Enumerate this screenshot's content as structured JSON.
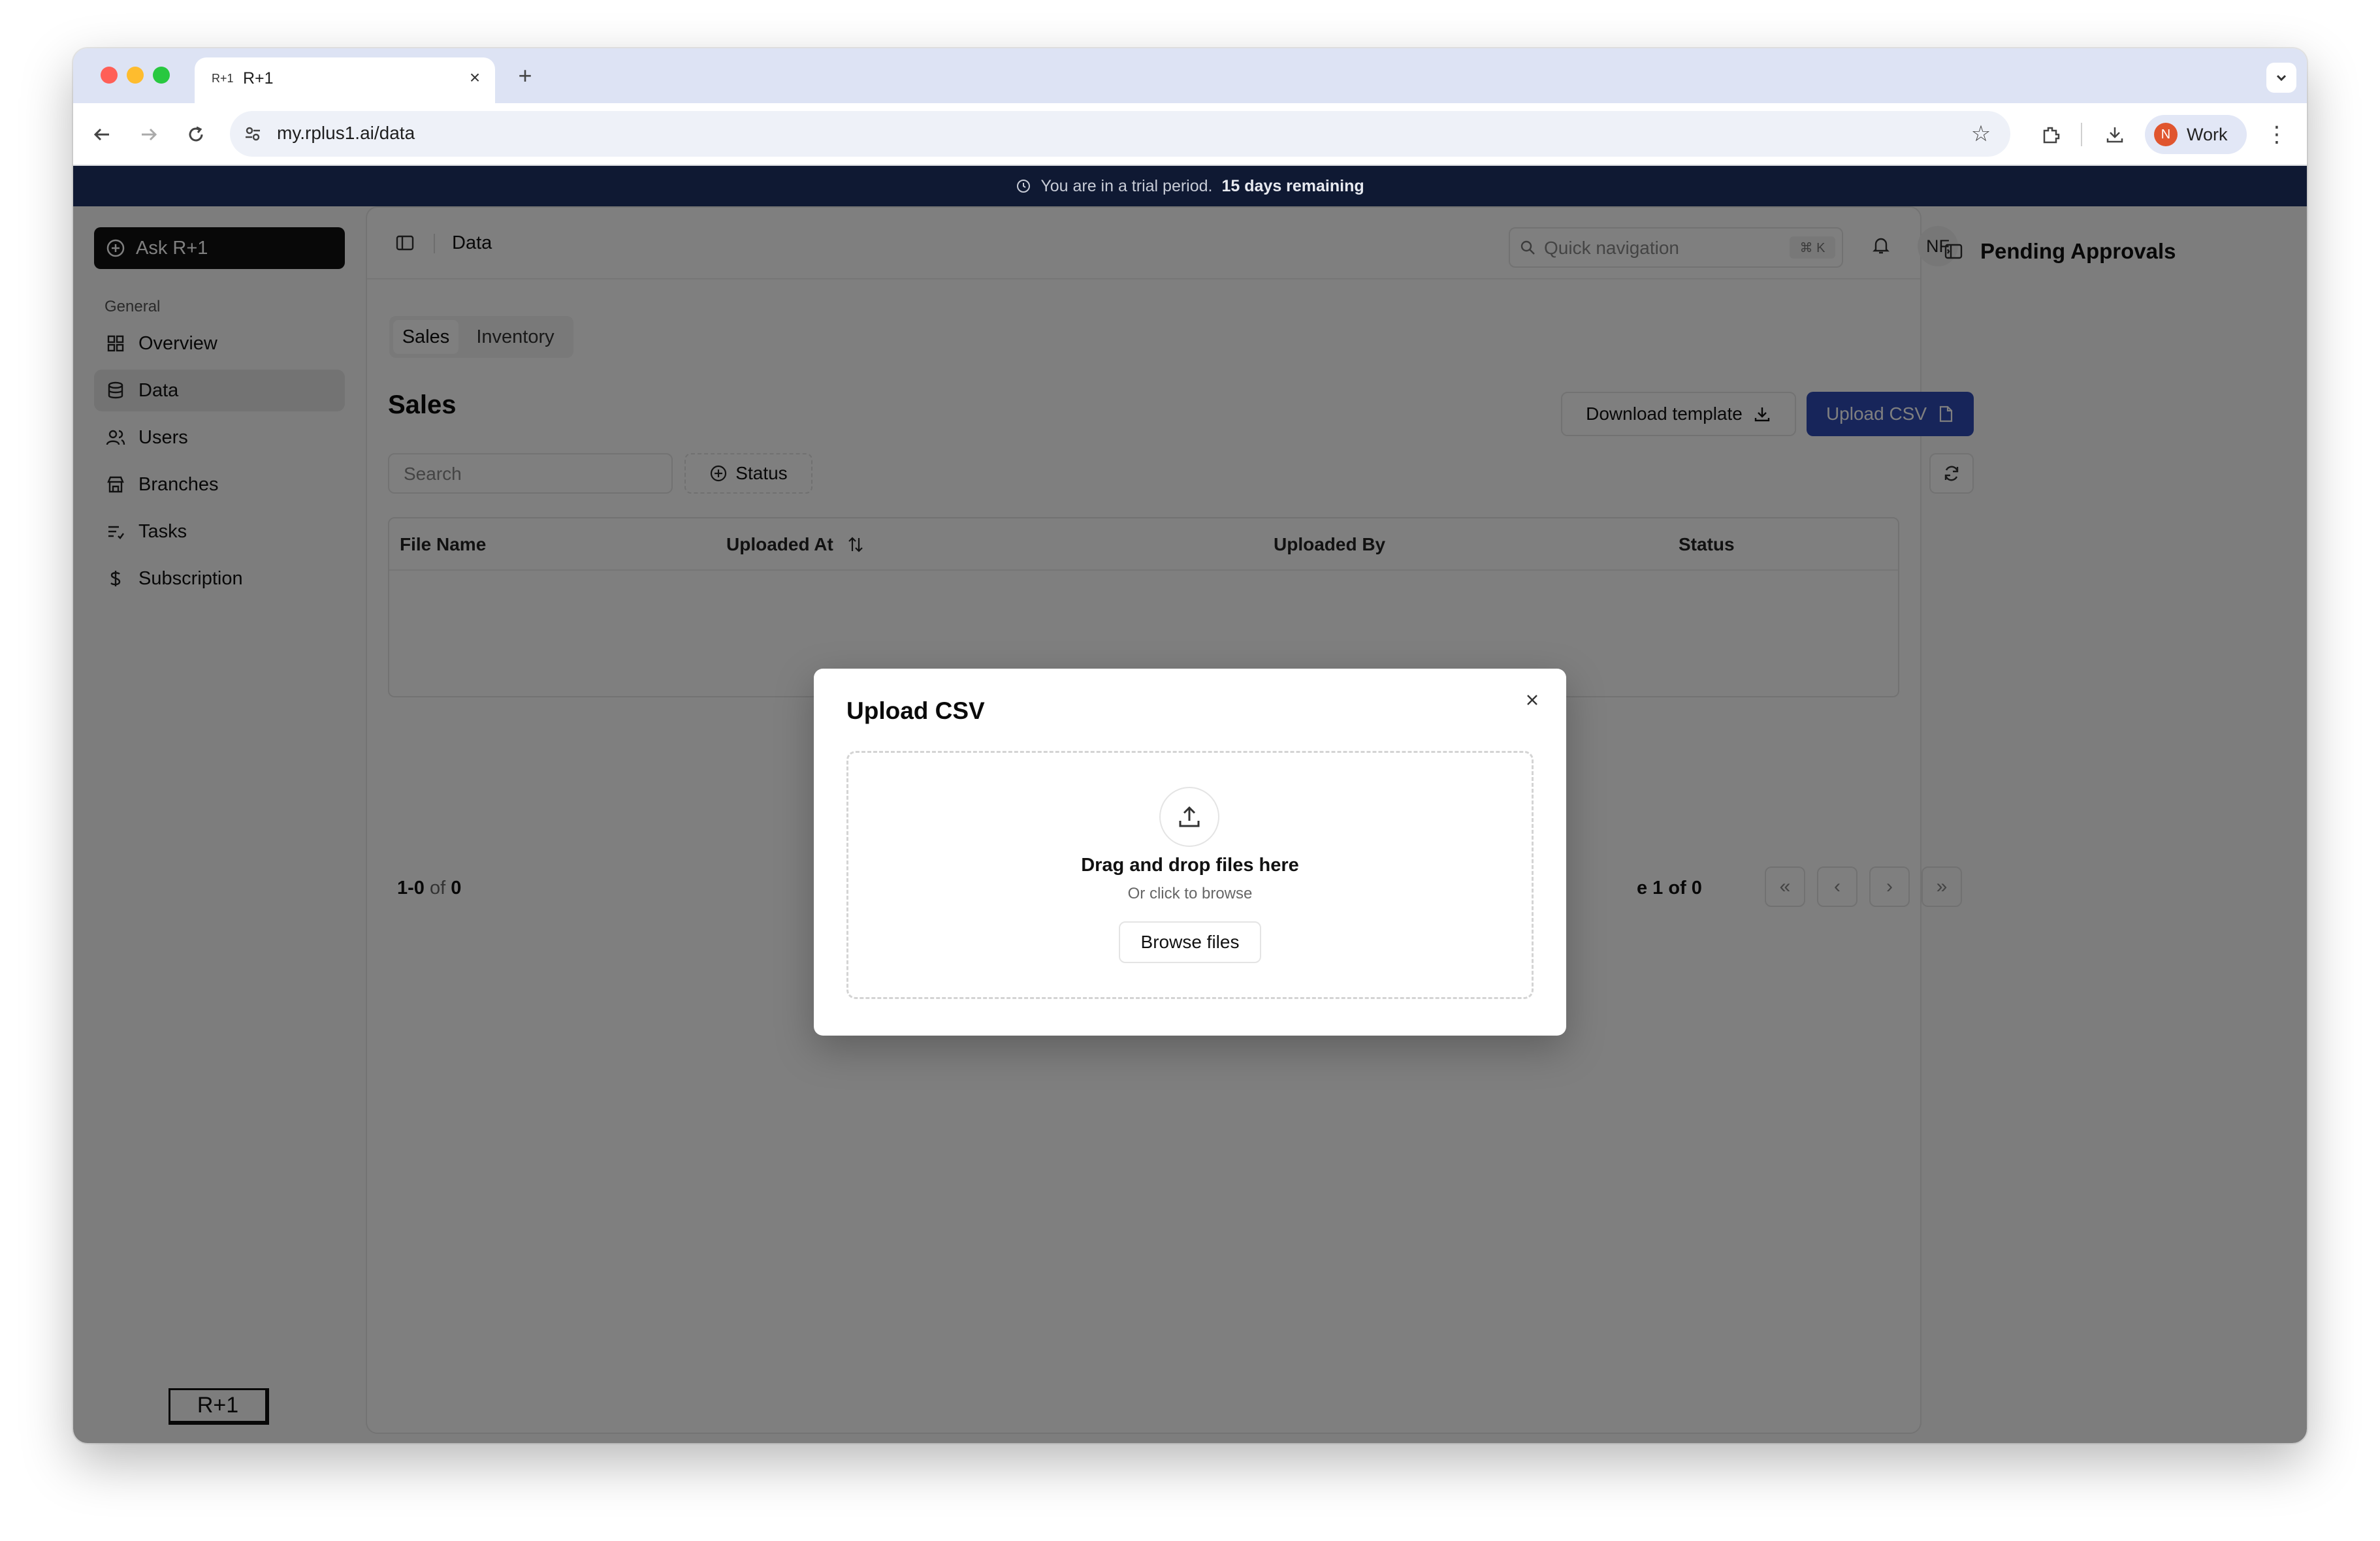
{
  "browser": {
    "tab_icon_text": "R+1",
    "tab_title": "R+1",
    "url": "my.rplus1.ai/data",
    "profile_initial": "N",
    "profile_label": "Work"
  },
  "banner": {
    "text": "You are in a trial period.",
    "emphasis": "15 days remaining"
  },
  "sidebar": {
    "ask_label": "Ask R+1",
    "section_label": "General",
    "items": [
      {
        "label": "Overview",
        "icon": "grid-icon"
      },
      {
        "label": "Data",
        "icon": "database-icon",
        "active": true
      },
      {
        "label": "Users",
        "icon": "users-icon"
      },
      {
        "label": "Branches",
        "icon": "store-icon"
      },
      {
        "label": "Tasks",
        "icon": "list-icon"
      },
      {
        "label": "Subscription",
        "icon": "dollar-icon"
      }
    ],
    "logo_text": "R+1"
  },
  "header": {
    "breadcrumb": "Data",
    "search_placeholder": "Quick navigation",
    "shortcut": "⌘ K",
    "avatar_initials": "NF"
  },
  "tabs": [
    {
      "label": "Sales",
      "active": true
    },
    {
      "label": "Inventory",
      "active": false
    }
  ],
  "content": {
    "title": "Sales",
    "download_label": "Download template",
    "upload_label": "Upload CSV",
    "search_placeholder": "Search",
    "status_filter_label": "Status"
  },
  "table": {
    "columns": [
      "File Name",
      "Uploaded At",
      "Uploaded By",
      "Status"
    ],
    "rows": []
  },
  "pagination": {
    "range_start": "1-0",
    "range_of": "of",
    "range_total": "0",
    "page_text_partial": "e 1 of 0"
  },
  "right_panel": {
    "title": "Pending Approvals"
  },
  "modal": {
    "title": "Upload CSV",
    "drop_title": "Drag and drop files here",
    "drop_subtitle": "Or click to browse",
    "browse_label": "Browse files"
  },
  "colors": {
    "primary": "#2f4bb5",
    "banner_bg": "#0f1933",
    "ask_button_bg": "#111111"
  }
}
